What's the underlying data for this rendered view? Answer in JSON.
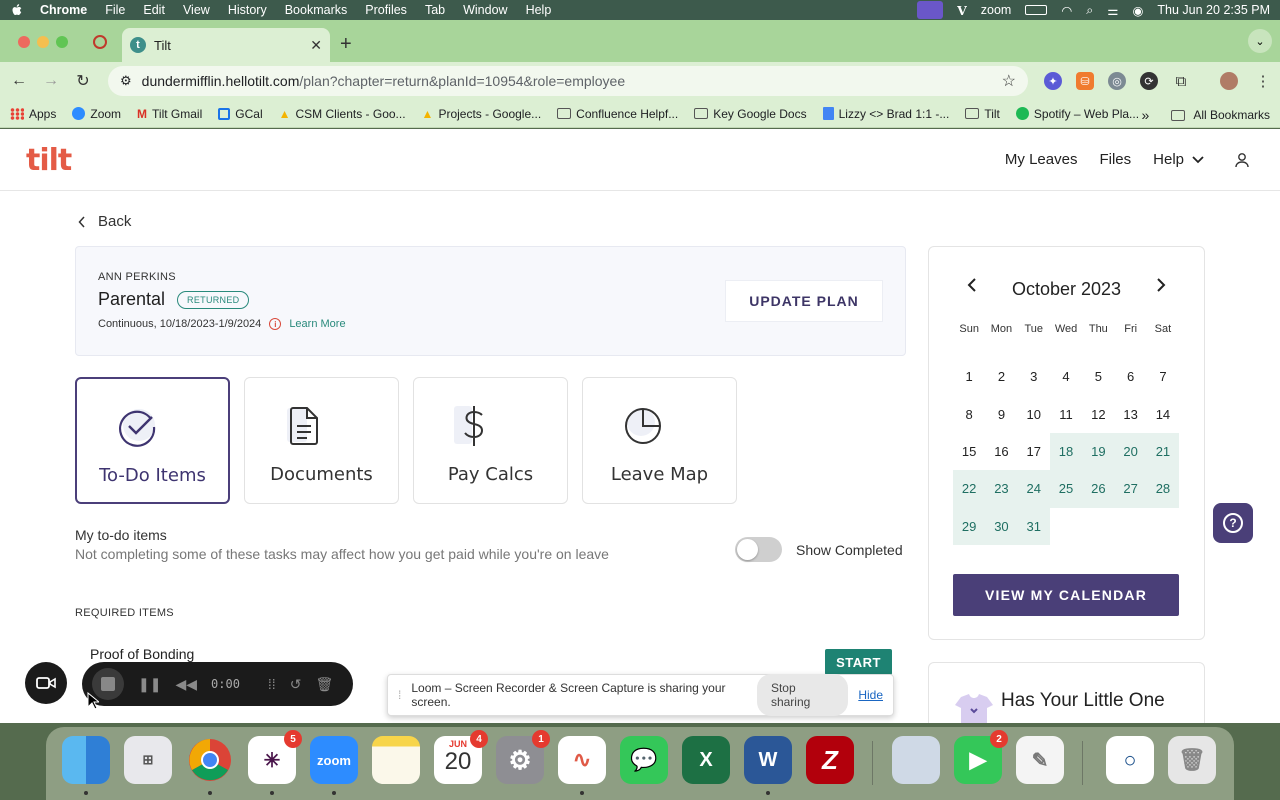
{
  "menubar": {
    "items": [
      "Chrome",
      "File",
      "Edit",
      "View",
      "History",
      "Bookmarks",
      "Profiles",
      "Tab",
      "Window",
      "Help"
    ],
    "zoom": "zoom",
    "datetime": "Thu Jun 20  2:35 PM"
  },
  "browser": {
    "tab_title": "Tilt",
    "url_host": "dundermifflin.hellotilt.com",
    "url_path": "/plan?chapter=return&planId=10954&role=employee",
    "bookmarks": [
      "Apps",
      "Zoom",
      "Tilt Gmail",
      "GCal",
      "CSM Clients - Goo...",
      "Projects - Google...",
      "Confluence Helpf...",
      "Key Google Docs",
      "Lizzy <> Brad 1:1 -...",
      "Tilt",
      "Spotify – Web Pla..."
    ],
    "all_bookmarks": "All Bookmarks"
  },
  "app": {
    "logo": "tilt",
    "nav": {
      "my_leaves": "My Leaves",
      "files": "Files",
      "help": "Help"
    },
    "back": "Back",
    "plan": {
      "employee": "ANN PERKINS",
      "type": "Parental",
      "status": "RETURNED",
      "dates": "Continuous, 10/18/2023-1/9/2024",
      "learn_more": "Learn More",
      "update_button": "UPDATE PLAN"
    },
    "tiles": [
      "To-Do Items",
      "Documents",
      "Pay Calcs",
      "Leave Map"
    ],
    "todo": {
      "heading": "My to-do items",
      "subtext": "Not completing some of these tasks may affect how you get paid while you're on leave",
      "show_completed": "Show Completed",
      "required_heading": "REQUIRED ITEMS",
      "item": "Proof of Bonding",
      "start": "START"
    },
    "calendar": {
      "month": "October 2023",
      "dow": [
        "Sun",
        "Mon",
        "Tue",
        "Wed",
        "Thu",
        "Fri",
        "Sat"
      ],
      "days": [
        "1",
        "2",
        "3",
        "4",
        "5",
        "6",
        "7",
        "8",
        "9",
        "10",
        "11",
        "12",
        "13",
        "14",
        "15",
        "16",
        "17",
        "18",
        "19",
        "20",
        "21",
        "22",
        "23",
        "24",
        "25",
        "26",
        "27",
        "28",
        "29",
        "30",
        "31"
      ],
      "leave_start_day": 18,
      "button": "VIEW MY CALENDAR"
    },
    "promo": "Has Your Little One"
  },
  "loom": {
    "time": "0:00",
    "message": "Loom – Screen Recorder & Screen Capture is sharing your screen.",
    "stop_sharing": "Stop sharing",
    "hide": "Hide"
  },
  "dock": {
    "badges": {
      "slack": "5",
      "calendar": "4",
      "settings": "1",
      "facetime": "2"
    },
    "calendar_month": "JUN",
    "calendar_day": "20",
    "zoom_label": "zoom"
  },
  "colors": {
    "brand_red": "#e45b46",
    "brand_purple": "#4a3f78",
    "teal": "#1e8373",
    "leave_bg": "#e7f2ee"
  }
}
